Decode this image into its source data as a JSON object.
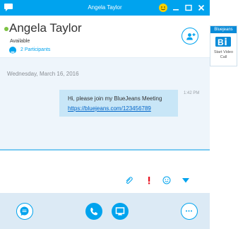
{
  "window": {
    "title": "Angela Taylor"
  },
  "contact": {
    "name": "Angela Taylor",
    "status": "Available",
    "participants_label": "2 Participants"
  },
  "conversation": {
    "date": "Wednesday, March 16, 2016",
    "message": {
      "text": "Hi, please join my BlueJeans Meeting",
      "link": "https://bluejeans.com/123456789",
      "time": "1:42 PM"
    }
  },
  "bluejeans_panel": {
    "header": "Bluejeans",
    "action_label": "Start Video Call"
  },
  "colors": {
    "accent": "#00a3ee",
    "presence_available": "#7dc243",
    "important": "#e8101e",
    "bluejeans": "#0a8bd8"
  },
  "icons": {
    "title_bar": [
      "skype-chat-icon",
      "emoticon-icon",
      "minimize-icon",
      "maximize-icon",
      "close-icon"
    ],
    "compose": [
      "paperclip-icon",
      "exclamation-icon",
      "smiley-icon",
      "send-arrow-icon"
    ],
    "bottom_bar": [
      "chat-icon",
      "phone-icon",
      "video-call-icon",
      "more-icon"
    ]
  }
}
